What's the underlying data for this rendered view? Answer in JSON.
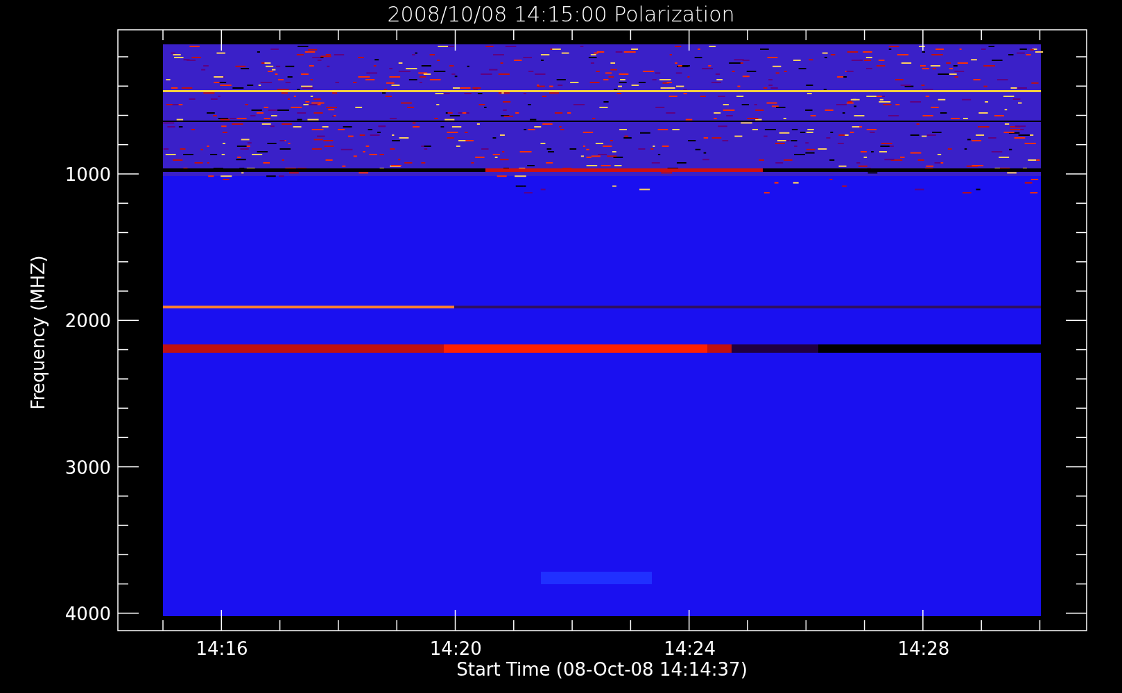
{
  "title": "2008/10/08 14:15:00 Polarization",
  "y_axis": {
    "label": "Frequency (MHZ)",
    "ticks": [
      "1000",
      "2000",
      "3000",
      "4000"
    ]
  },
  "x_axis": {
    "label": "Start Time (08-Oct-08 14:14:37)",
    "ticks": [
      "14:16",
      "14:20",
      "14:24",
      "14:28"
    ]
  }
}
